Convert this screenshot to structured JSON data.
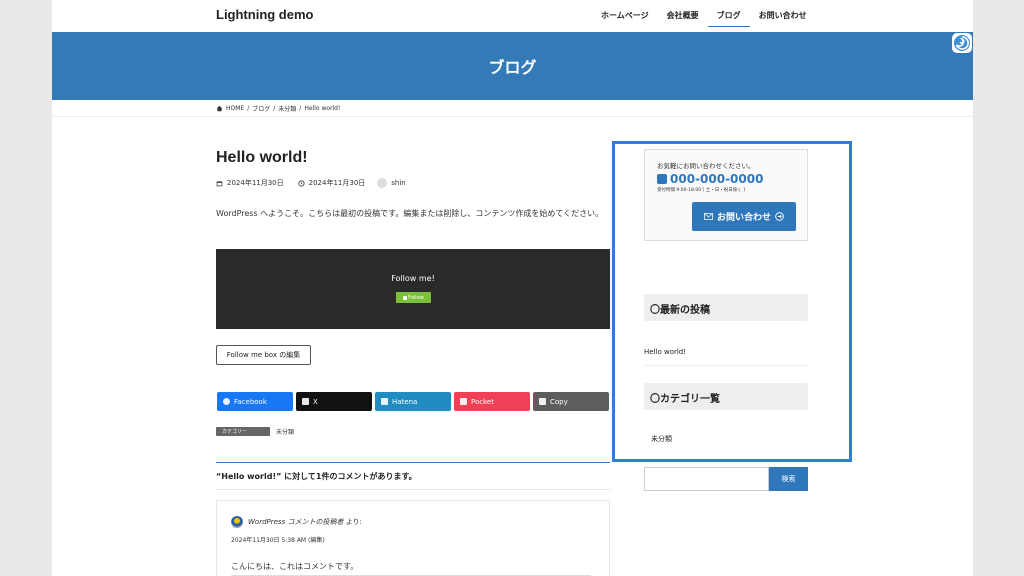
{
  "header": {
    "site_title": "Lightning demo",
    "nav": [
      "ホームページ",
      "会社概要",
      "ブログ",
      "お問い合わせ"
    ]
  },
  "hero": {
    "title": "ブログ"
  },
  "breadcrumb": [
    "HOME",
    "ブログ",
    "未分類",
    "Hello world!"
  ],
  "post": {
    "title": "Hello world!",
    "published": "2024年11月30日",
    "updated": "2024年11月30日",
    "author": "shin",
    "body": "WordPress へようこそ。こちらは最初の投稿です。編集または削除し、コンテンツ作成を始めてください。"
  },
  "follow": {
    "title": "Follow me!",
    "button": "Follow"
  },
  "edit_button": "Follow me box の編集",
  "share": [
    {
      "label": "Facebook",
      "color": "#1877f2",
      "icon": "facebook-icon"
    },
    {
      "label": "X",
      "color": "#111111",
      "icon": "x-icon"
    },
    {
      "label": "Hatena",
      "color": "#1f8dc1",
      "icon": "hatena-icon"
    },
    {
      "label": "Pocket",
      "color": "#ef4056",
      "icon": "pocket-icon"
    },
    {
      "label": "Copy",
      "color": "#5d5d5d",
      "icon": "copy-icon"
    }
  ],
  "category": {
    "tag": "カテゴリー",
    "value": "未分類"
  },
  "comments": {
    "title": "“Hello world!” に対して1件のコメントがあります。",
    "author": "WordPress コメントの投稿者",
    "author_suffix": "より:",
    "date": "2024年11月30日 5:38 AM",
    "edit": "(編集)",
    "text": "こんにちは、これはコメントです。"
  },
  "sidebar": {
    "contact": {
      "lead": "お気軽にお問い合わせください。",
      "phone": "000-000-0000",
      "hours": "受付時間 9:00-18:00 [ 土・日・祝日除く ]",
      "button": "お問い合わせ"
    },
    "recent_title": "〇最新の投稿",
    "recent_items": [
      "Hello world!"
    ],
    "category_title": "〇カテゴリ一覧",
    "category_items": [
      "未分類"
    ],
    "search_button": "検索"
  },
  "colors": {
    "accent": "#337ab7",
    "highlight": "#2f7ed2"
  }
}
